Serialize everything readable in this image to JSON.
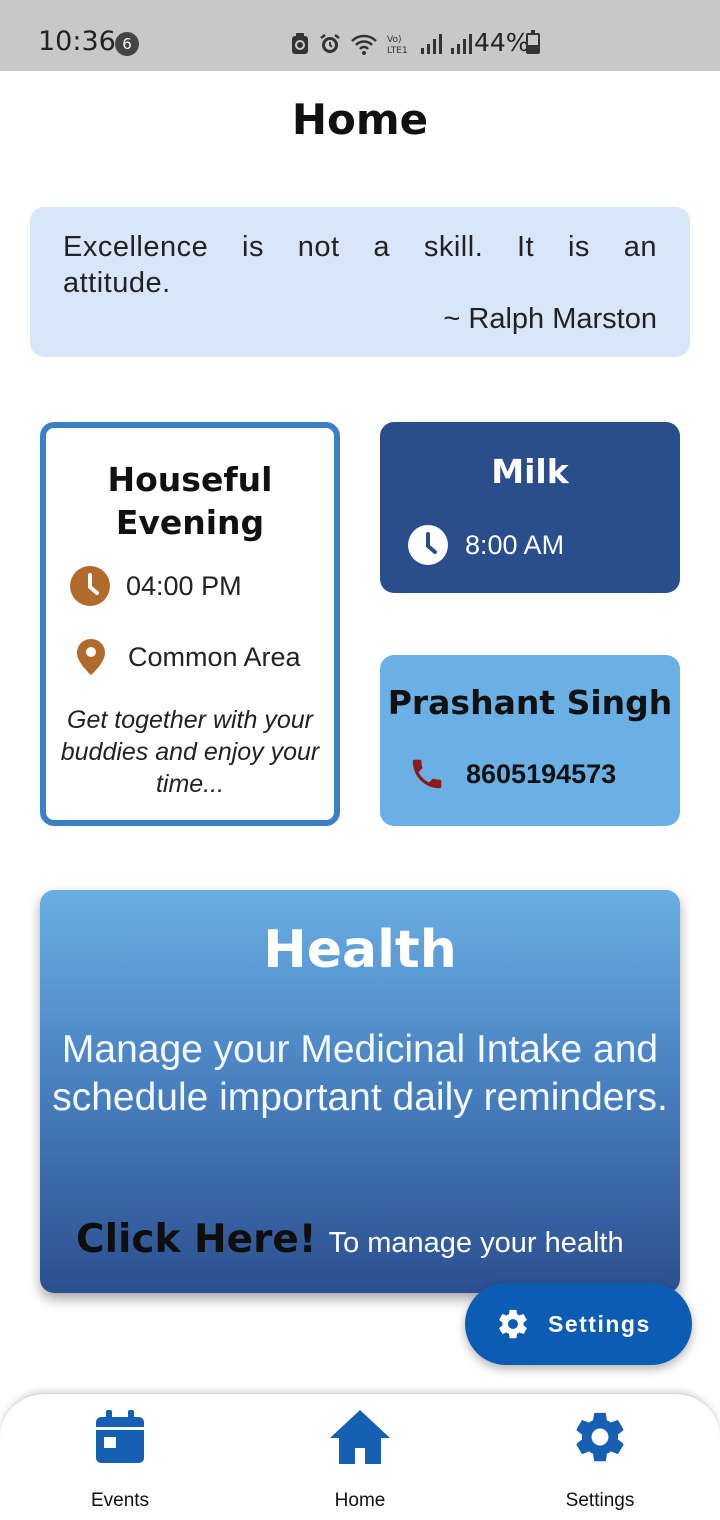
{
  "status_bar": {
    "time": "10:36",
    "notification_count": "6",
    "battery_percent": "44%"
  },
  "header": {
    "title": "Home"
  },
  "quote": {
    "text": "Excellence is not a skill. It is an attitude.",
    "author": "~ Ralph Marston"
  },
  "event_card": {
    "title": "Houseful Evening",
    "time": "04:00 PM",
    "location": "Common Area",
    "description": "Get together with your buddies and enjoy your time..."
  },
  "reminder_card": {
    "title": "Milk",
    "time": "8:00 AM"
  },
  "contact_card": {
    "name": "Prashant Singh",
    "phone": "8605194573"
  },
  "health_card": {
    "title": "Health",
    "body": "Manage your Medicinal Intake and schedule important daily reminders.",
    "cta_bold": "Click Here!",
    "cta_rest": "To manage your health"
  },
  "fab": {
    "label": "Settings",
    "icon": "gear-icon"
  },
  "bottom_nav": {
    "items": [
      {
        "label": "Events",
        "icon": "calendar-icon"
      },
      {
        "label": "Home",
        "icon": "home-icon"
      },
      {
        "label": "Settings",
        "icon": "gear-icon"
      }
    ]
  },
  "colors": {
    "primary": "#0d5cb4",
    "event_border": "#3b80c7",
    "reminder_bg": "#2a4d8c",
    "contact_bg": "#6ab0e4",
    "quote_bg": "#d9e6fa",
    "accent_brown": "#b06a2c",
    "phone_red": "#8b1a1a",
    "nav_icon": "#1660b4"
  }
}
